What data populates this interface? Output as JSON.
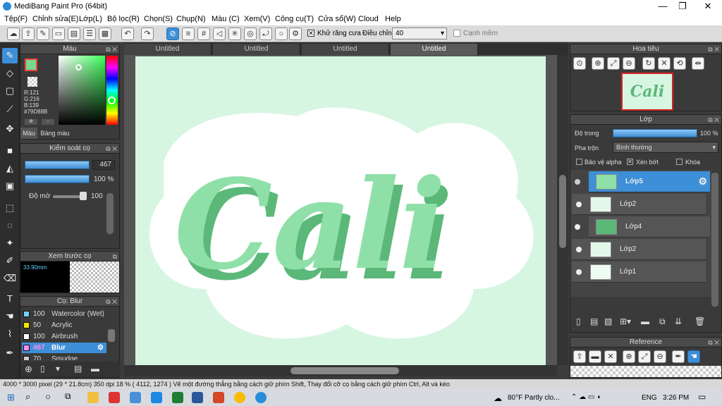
{
  "window": {
    "title": "MediBang Paint Pro (64bit)",
    "minimize": "—",
    "maximize": "❐",
    "close": "✕"
  },
  "menu": [
    "Tệp(F)",
    "Chỉnh sửa(E)",
    "Lớp(L)",
    "Bộ lọc(R)",
    "Chọn(S)",
    "Chụp(N)",
    "Màu (C)",
    "Xem(V)",
    "Công cụ(T)",
    "Cửa sổ(W)",
    "Cloud",
    "Help"
  ],
  "toolbar": {
    "antialias_label": "Khử răng cưa",
    "correction_label": "Điều chỉnh",
    "correction_value": "40",
    "soft_edge_label": "Cạnh mềm"
  },
  "color_panel": {
    "title": "Màu",
    "r": "R:121",
    "g": "G:216",
    "b": "B:139",
    "hex": "#79D88B",
    "tab_color": "Màu",
    "tab_palette": "Bảng màu",
    "accent": "#79D88B"
  },
  "brush_control": {
    "title": "Kiểm soát cọ",
    "size": "467",
    "density": "100 %",
    "opacity_label": "Độ mờ",
    "opacity": "100"
  },
  "brush_preview": {
    "title": "Xem trước cọ",
    "size_text": "33.90mm"
  },
  "brush_list": {
    "title": "Cọ: Blur",
    "items": [
      {
        "size": "100",
        "name": "Watercolor (Wet)",
        "color": "#6fd3ff"
      },
      {
        "size": "50",
        "name": "Acrylic",
        "color": "#f2e600"
      },
      {
        "size": "100",
        "name": "Airbrush",
        "color": "#ffffff"
      },
      {
        "size": "467",
        "name": "Blur",
        "color": "#ff8cf0"
      },
      {
        "size": "70",
        "name": "Smudge",
        "color": "#cccccc"
      }
    ]
  },
  "tabs": [
    "Untitled",
    "Untitled",
    "Untitled",
    "Untitled"
  ],
  "canvas": {
    "artwork_text": "Cali",
    "bg": "#d7f6e2"
  },
  "navigator": {
    "title": "Hoa tiêu",
    "thumb_text": "Cali"
  },
  "layers": {
    "title": "Lớp",
    "opacity_label": "Độ trong",
    "opacity_value": "100 %",
    "blend_label": "Pha trộn",
    "blend_value": "Bình thường",
    "protect_alpha": "Bảo vệ alpha",
    "clipping": "Xén bớt",
    "lock": "Khóa",
    "items": [
      "Lớp5",
      "Lớp2",
      "Lớp4",
      "Lớp2",
      "Lớp1"
    ]
  },
  "reference": {
    "title": "Reference"
  },
  "status": {
    "text": "4000 * 3000 pixel   (29 * 21.8cm)   350 dpi   18 %   ( 4112, 1274 )   Vẽ một đường thẳng bằng cách giữ phím Shift, Thay đổi cỡ cọ bằng cách giữ phím Ctrl, Alt và kéo"
  },
  "taskbar": {
    "weather": "80°F  Partly clo...",
    "lang": "ENG",
    "time": "3:26 PM"
  }
}
